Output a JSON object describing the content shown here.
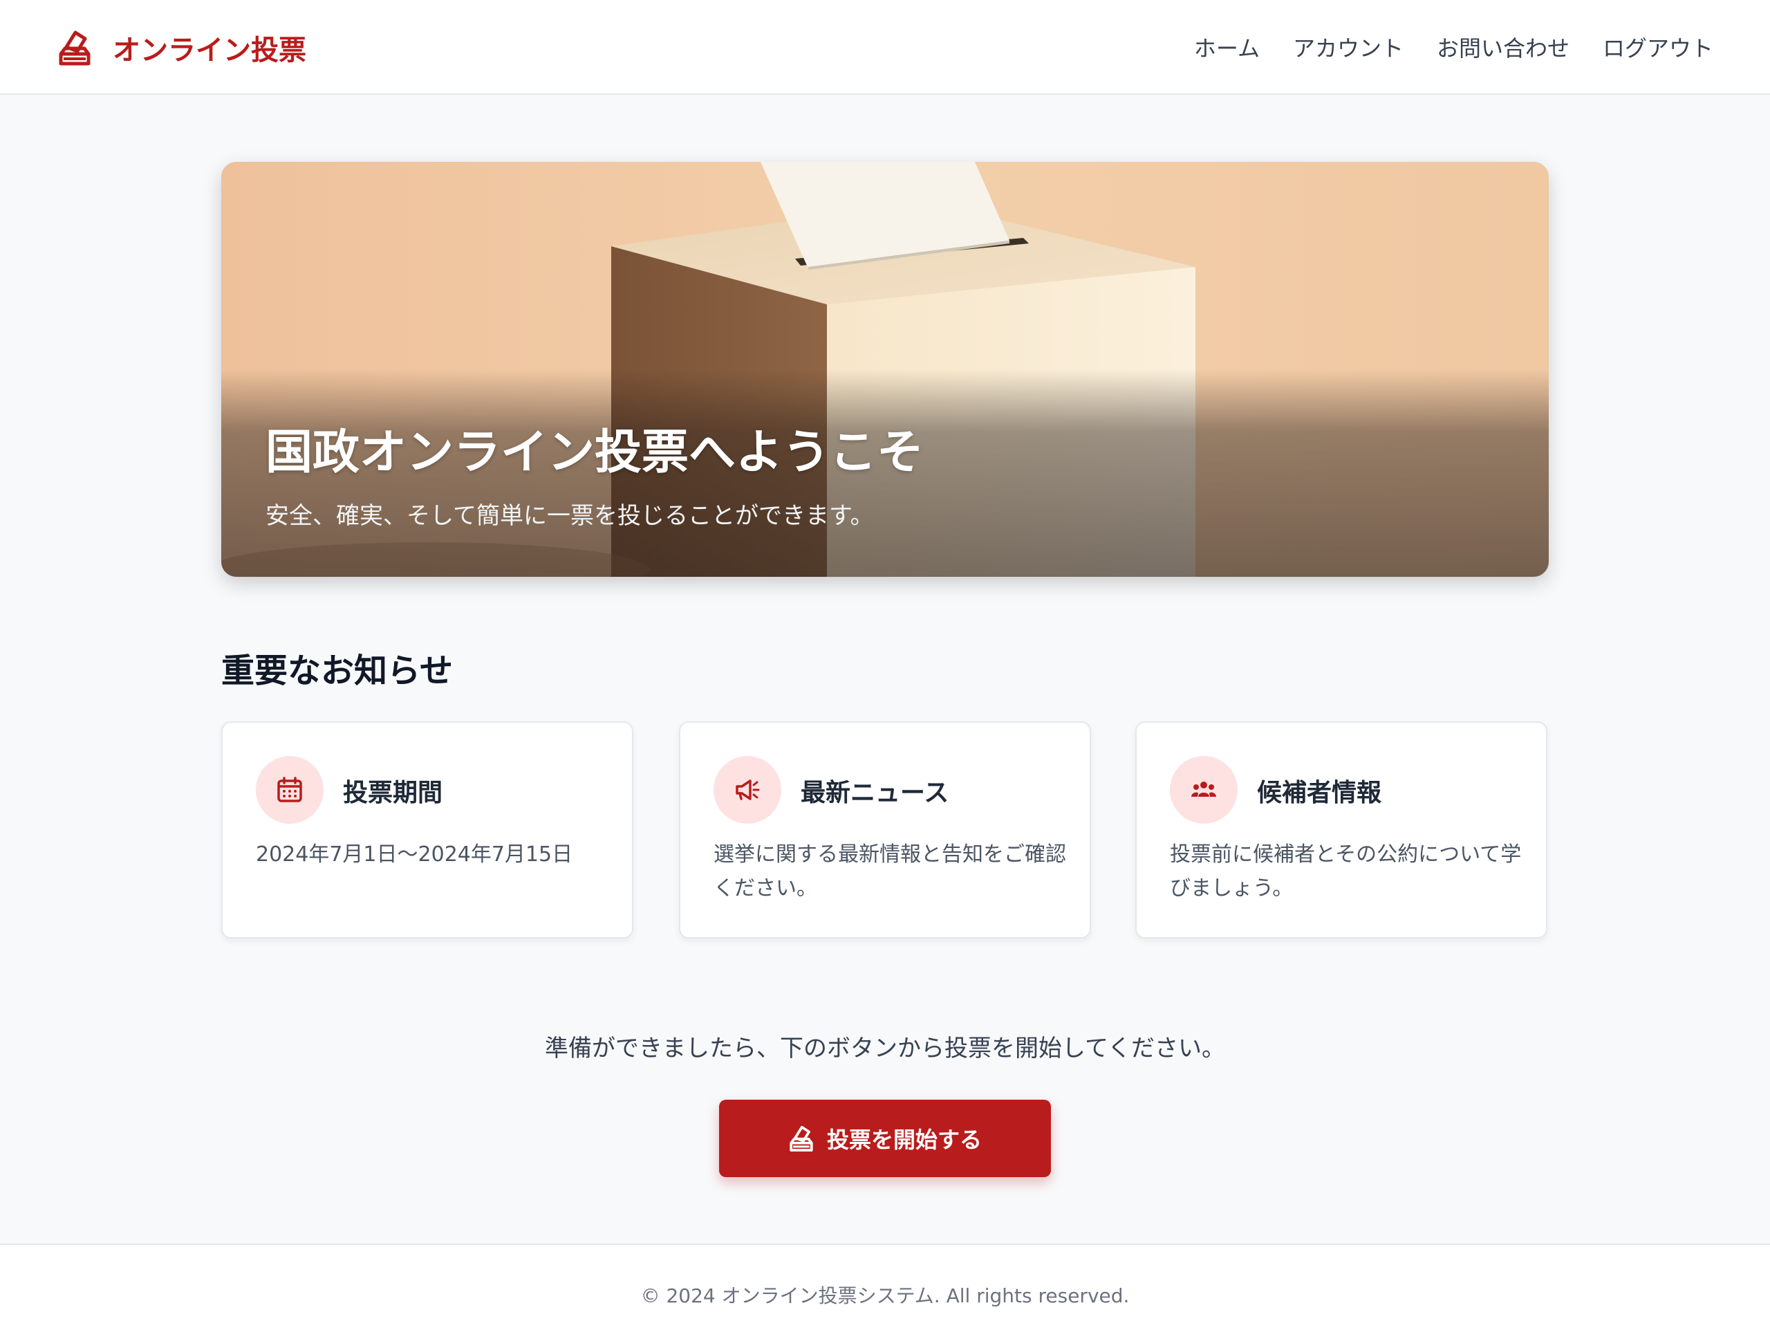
{
  "header": {
    "brand": {
      "title": "オンライン投票",
      "icon": "ballot-box-icon"
    },
    "nav": [
      "ホーム",
      "アカウント",
      "お問い合わせ",
      "ログアウト"
    ]
  },
  "hero": {
    "title": "国政オンライン投票へようこそ",
    "subtitle": "安全、確実、そして簡単に一票を投じることができます。",
    "image": "ballot-box-illustration"
  },
  "notices": {
    "title": "重要なお知らせ",
    "cards": [
      {
        "icon": "calendar-icon",
        "title": "投票期間",
        "body": "2024年7月1日〜2024年7月15日"
      },
      {
        "icon": "megaphone-icon",
        "title": "最新ニュース",
        "body": "選挙に関する最新情報と告知をご確認ください。"
      },
      {
        "icon": "users-icon",
        "title": "候補者情報",
        "body": "投票前に候補者とその公約について学びましょう。"
      }
    ]
  },
  "cta": {
    "text": "準備ができましたら、下のボタンから投票を開始してください。",
    "button": "投票を開始する",
    "icon": "ballot-box-icon"
  },
  "footer": {
    "text": "© 2024 オンライン投票システム. All rights reserved."
  },
  "colors": {
    "brand": "#b91c1c",
    "icon_bg": "#fee2e2",
    "page_bg": "#f8f9fb"
  }
}
